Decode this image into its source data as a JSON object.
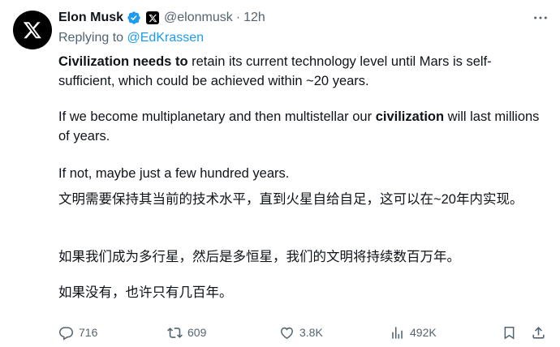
{
  "author": {
    "name": "Elon Musk",
    "handle": "@elonmusk",
    "time": "12h"
  },
  "reply": {
    "prefix": "Replying to ",
    "to": "@EdKrassen"
  },
  "tweet": {
    "p1_bold": "Civilization needs to",
    "p1_rest": " retain its current technology level until Mars is self-sufficient, which could be achieved within ~20 years.",
    "p2_start": "If we become multiplanetary and then multistellar our ",
    "p2_bold": "civilization",
    "p2_end": " will last millions of years.",
    "p3": "If not, maybe just a few hundred years.",
    "p4": "文明需要保持其当前的技术水平，直到火星自给自足，这可以在~20年内实现。",
    "p5": "如果我们成为多行星，然后是多恒星，我们的文明将持续数百万年。",
    "p6": "如果没有，也许只有几百年。"
  },
  "stats": {
    "replies": "716",
    "reposts": "609",
    "likes": "3.8K",
    "views": "492K"
  },
  "icons": [
    "x-logo-icon",
    "verified-badge-icon",
    "x-affiliate-icon",
    "more-icon",
    "reply-icon",
    "repost-icon",
    "like-icon",
    "views-icon",
    "bookmark-icon",
    "share-icon"
  ],
  "colors": {
    "link": "#1d9bf0",
    "muted": "#536471",
    "text": "#0f1419"
  }
}
